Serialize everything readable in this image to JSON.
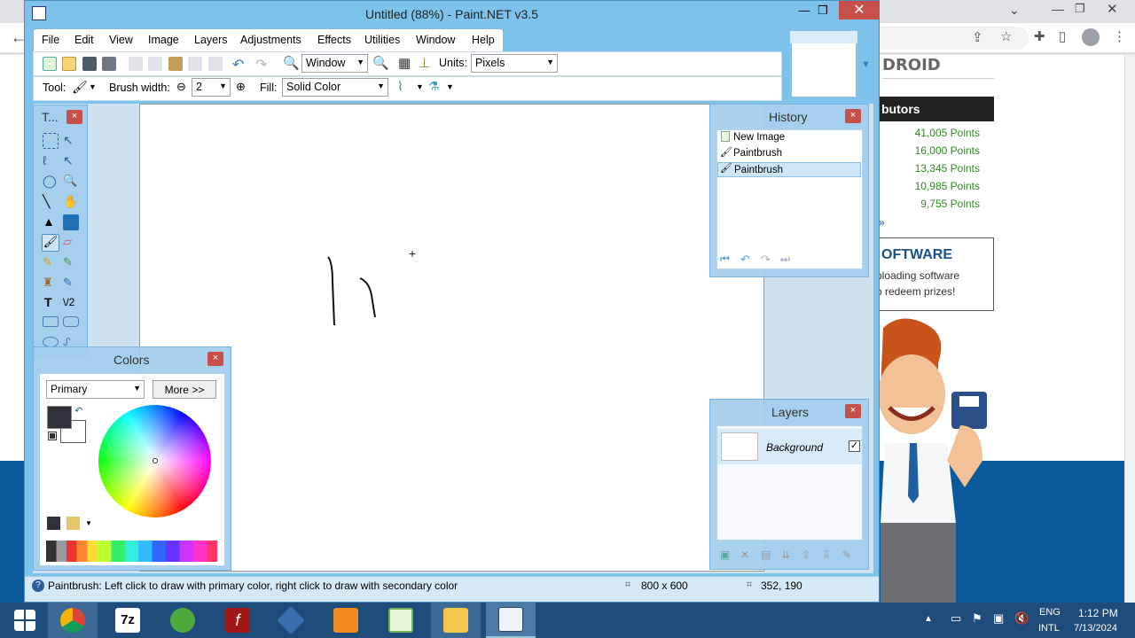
{
  "browser": {
    "site_logo_text": "DROID",
    "contributors_header": "butors",
    "points": [
      "41,005 Points",
      "16,000 Points",
      "13,345 Points",
      "10,985 Points",
      "9,755 Points"
    ],
    "more_link": "»",
    "software_title": "OFTWARE",
    "software_line1": "ploading software",
    "software_line2": "o redeem prizes!"
  },
  "paint": {
    "title": "Untitled (88%) - Paint.NET v3.5",
    "menu": [
      "File",
      "Edit",
      "View",
      "Image",
      "Layers",
      "Adjustments",
      "Effects",
      "Utilities",
      "Window",
      "Help"
    ],
    "toolbar": {
      "zoom_value": "Window",
      "units_label": "Units:",
      "units_value": "Pixels",
      "tool_label": "Tool:",
      "brush_width_label": "Brush width:",
      "brush_width_value": "2",
      "fill_label": "Fill:",
      "fill_value": "Solid Color"
    },
    "tools_window_title": "T...",
    "colors": {
      "title": "Colors",
      "mode_value": "Primary",
      "more_button": "More >>",
      "primary_color": "#2e3238",
      "secondary_color": "#ffffff"
    },
    "history": {
      "title": "History",
      "items": [
        "New Image",
        "Paintbrush",
        "Paintbrush"
      ]
    },
    "layers": {
      "title": "Layers",
      "items": [
        {
          "name": "Background",
          "visible": true
        }
      ]
    },
    "status": {
      "hint": "Paintbrush: Left click to draw with primary color, right click to draw with secondary color",
      "image_size": "800 x 600",
      "cursor_pos": "352, 190"
    }
  },
  "taskbar": {
    "apps": [
      "start-icon",
      "chrome-icon",
      "7zip-icon",
      "utorrent-icon",
      "flash-icon",
      "virtualbox-icon",
      "filezilla-icon",
      "notepadpp-icon",
      "explorer-icon",
      "paintnet-icon"
    ],
    "lang_top": "ENG",
    "lang_bottom": "INTL",
    "time": "1:12 PM",
    "date": "7/13/2024"
  },
  "colors": {
    "accent": "#7cc2eb",
    "close_red": "#c7504a",
    "taskbar": "#1e4d7c"
  }
}
